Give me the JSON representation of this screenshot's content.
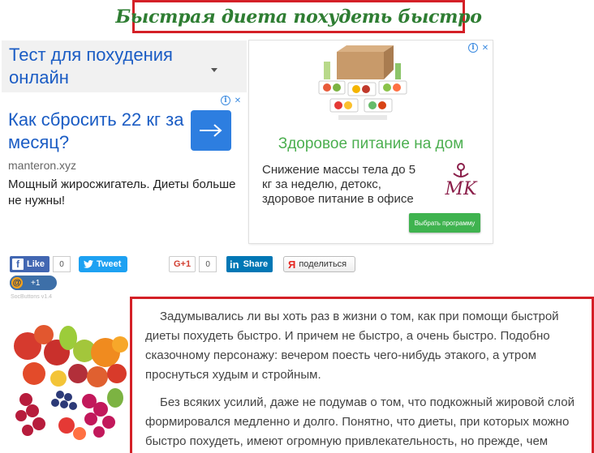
{
  "title": "Быстрая диета похудеть быстро",
  "ad_left": {
    "dropdown_text": "Тест для похудения онлайн",
    "headline": "Как сбросить 22 кг за месяц?",
    "domain": "manteron.xyz",
    "description": "Мощный жиросжигатель. Диеты больше не нужны!"
  },
  "ad_right": {
    "title": "Здоровое питание на дом",
    "description": "Снижение массы тела до 5 кг за неделю, детокс, здоровое питание в офисе",
    "cta": "Выбрать программу",
    "logo_letters": "MK"
  },
  "social": {
    "fb_label": "Like",
    "fb_count": "0",
    "tw_label": "Tweet",
    "gp_label": "G+1",
    "gp_count": "0",
    "li_logo": "in",
    "li_label": "Share",
    "ya_label": "поделиться",
    "mail_count": "+1",
    "mail_at": "@",
    "caption": "SocButtons v1.4"
  },
  "article": {
    "paragraphs": [
      "Задумывались ли вы хоть раз в жизни о том, как при помощи быстрой диеты похудеть быстро. И причем не быстро, а очень быстро. Подобно сказочному персонажу: вечером поесть чего-нибудь этакого, а утром проснуться худым и стройным.",
      "Без всяких усилий, даже не подумав о том, что подкожный жировой слой формировался медленно и долго. Понятно, что диеты, при которых можно быстро похудеть, имеют огромную привлекательность, но прежде, чем"
    ]
  },
  "colors": {
    "accent_red": "#d42027",
    "title_green": "#2e7d32",
    "link_blue": "#1a5cc4",
    "ad_green": "#4caf50"
  }
}
